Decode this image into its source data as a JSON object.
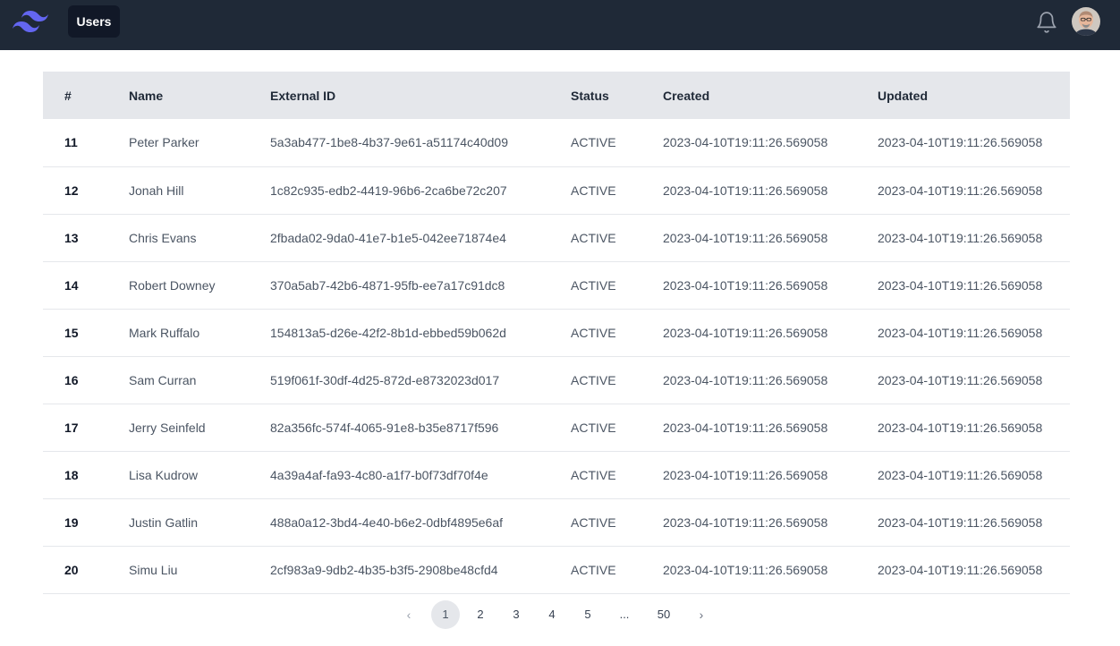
{
  "nav": {
    "active_tab": "Users",
    "logo_icon": "tailwind-logo-icon",
    "bell_icon": "bell-icon",
    "avatar_icon": "user-avatar"
  },
  "table": {
    "columns": [
      "#",
      "Name",
      "External ID",
      "Status",
      "Created",
      "Updated"
    ],
    "rows": [
      {
        "id": "11",
        "name": "Peter Parker",
        "external_id": "5a3ab477-1be8-4b37-9e61-a51174c40d09",
        "status": "ACTIVE",
        "created": "2023-04-10T19:11:26.569058",
        "updated": "2023-04-10T19:11:26.569058"
      },
      {
        "id": "12",
        "name": "Jonah Hill",
        "external_id": "1c82c935-edb2-4419-96b6-2ca6be72c207",
        "status": "ACTIVE",
        "created": "2023-04-10T19:11:26.569058",
        "updated": "2023-04-10T19:11:26.569058"
      },
      {
        "id": "13",
        "name": "Chris Evans",
        "external_id": "2fbada02-9da0-41e7-b1e5-042ee71874e4",
        "status": "ACTIVE",
        "created": "2023-04-10T19:11:26.569058",
        "updated": "2023-04-10T19:11:26.569058"
      },
      {
        "id": "14",
        "name": "Robert Downey",
        "external_id": "370a5ab7-42b6-4871-95fb-ee7a17c91dc8",
        "status": "ACTIVE",
        "created": "2023-04-10T19:11:26.569058",
        "updated": "2023-04-10T19:11:26.569058"
      },
      {
        "id": "15",
        "name": "Mark Ruffalo",
        "external_id": "154813a5-d26e-42f2-8b1d-ebbed59b062d",
        "status": "ACTIVE",
        "created": "2023-04-10T19:11:26.569058",
        "updated": "2023-04-10T19:11:26.569058"
      },
      {
        "id": "16",
        "name": "Sam Curran",
        "external_id": "519f061f-30df-4d25-872d-e8732023d017",
        "status": "ACTIVE",
        "created": "2023-04-10T19:11:26.569058",
        "updated": "2023-04-10T19:11:26.569058"
      },
      {
        "id": "17",
        "name": "Jerry Seinfeld",
        "external_id": "82a356fc-574f-4065-91e8-b35e8717f596",
        "status": "ACTIVE",
        "created": "2023-04-10T19:11:26.569058",
        "updated": "2023-04-10T19:11:26.569058"
      },
      {
        "id": "18",
        "name": "Lisa Kudrow",
        "external_id": "4a39a4af-fa93-4c80-a1f7-b0f73df70f4e",
        "status": "ACTIVE",
        "created": "2023-04-10T19:11:26.569058",
        "updated": "2023-04-10T19:11:26.569058"
      },
      {
        "id": "19",
        "name": "Justin Gatlin",
        "external_id": "488a0a12-3bd4-4e40-b6e2-0dbf4895e6af",
        "status": "ACTIVE",
        "created": "2023-04-10T19:11:26.569058",
        "updated": "2023-04-10T19:11:26.569058"
      },
      {
        "id": "20",
        "name": "Simu Liu",
        "external_id": "2cf983a9-9db2-4b35-b3f5-2908be48cfd4",
        "status": "ACTIVE",
        "created": "2023-04-10T19:11:26.569058",
        "updated": "2023-04-10T19:11:26.569058"
      }
    ]
  },
  "pagination": {
    "prev": "‹",
    "next": "›",
    "pages": [
      "1",
      "2",
      "3",
      "4",
      "5",
      "...",
      "50"
    ],
    "current": "1"
  },
  "colors": {
    "navbar": "#1f2937",
    "tab_active": "#111827",
    "header_row": "#e5e7eb",
    "logo": "#6366f1"
  }
}
